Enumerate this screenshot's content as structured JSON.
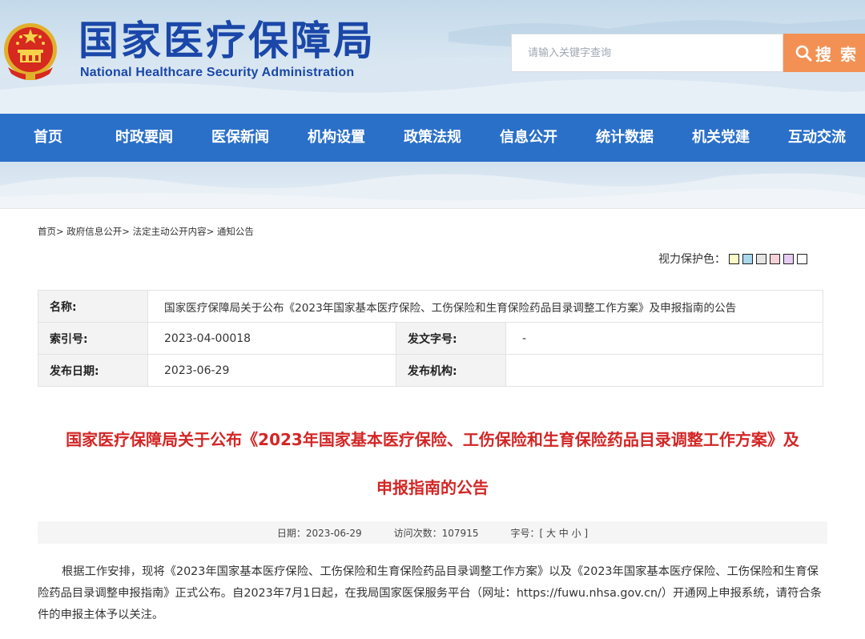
{
  "header": {
    "title_cn": "国家医疗保障局",
    "title_en": "National Healthcare Security Administration",
    "search_placeholder": "请输入关键字查询",
    "search_button": "搜 索",
    "emblem_icon": "national-emblem-icon",
    "search_icon": "search-icon"
  },
  "nav": {
    "items": [
      "首页",
      "时政要闻",
      "医保新闻",
      "机构设置",
      "政策法规",
      "信息公开",
      "统计数据",
      "机关党建",
      "互动交流"
    ]
  },
  "breadcrumb": "首页> 政府信息公开> 法定主动公开内容> 通知公告",
  "eye_protection": {
    "label": "视力保护色：",
    "colors": [
      "#fafac8",
      "#a9d7ee",
      "#e4e4e4",
      "#f6d2d6",
      "#e6ccf2",
      "#ffffff"
    ]
  },
  "meta": {
    "name_label": "名称:",
    "name_value": "国家医疗保障局关于公布《2023年国家基本医疗保险、工伤保险和生育保险药品目录调整工作方案》及申报指南的公告",
    "index_label": "索引号:",
    "index_value": "2023-04-00018",
    "docno_label": "发文字号:",
    "docno_value": "-",
    "date_label": "发布日期:",
    "date_value": "2023-06-29",
    "org_label": "发布机构:",
    "org_value": ""
  },
  "article": {
    "title_line1": "国家医疗保障局关于公布《2023年国家基本医疗保险、工伤保险和生育保险药品目录调整工作方案》及",
    "title_line2": "申报指南的公告",
    "date_info": "日期：2023-06-29",
    "visits_info": "访问次数：107915",
    "fontsize_info": "字号：[ 大 中 小 ]",
    "body": "根据工作安排，现将《2023年国家基本医疗保险、工伤保险和生育保险药品目录调整工作方案》以及《2023年国家基本医疗保险、工伤保险和生育保险药品目录调整申报指南》正式公布。自2023年7月1日起，在我局国家医保服务平台（网址：https://fuwu.nhsa.gov.cn/）开通网上申报系统，请符合条件的申报主体予以关注。"
  },
  "colors": {
    "brand_blue": "#1a47a8",
    "nav_blue": "#2a70c9",
    "search_orange": "#f39155",
    "title_red": "#d32626"
  }
}
